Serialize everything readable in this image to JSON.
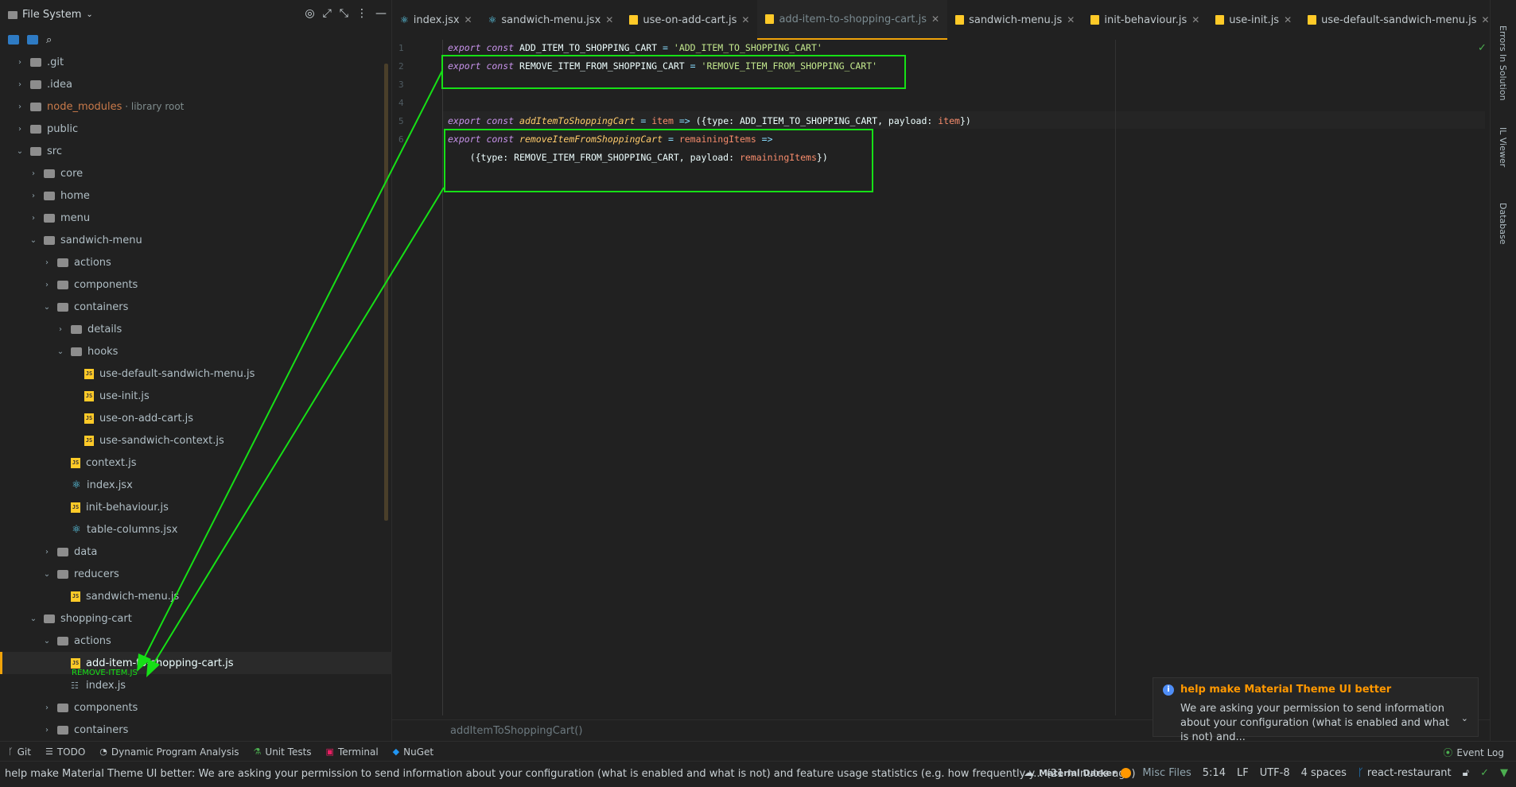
{
  "sidebar": {
    "title": "File System",
    "tree": [
      {
        "label": "git_l",
        "name": ".git"
      },
      {
        "name": ".idea"
      },
      {
        "name": "node_modules",
        "suffix": "library root"
      },
      {
        "name": "public"
      },
      {
        "name": "src"
      },
      {
        "name": "core"
      },
      {
        "name": "home"
      },
      {
        "name": "menu"
      },
      {
        "name": "sandwich-menu"
      },
      {
        "name": "actions"
      },
      {
        "name": "components"
      },
      {
        "name": "containers"
      },
      {
        "name": "details"
      },
      {
        "name": "hooks"
      },
      {
        "name": "use-default-sandwich-menu.js"
      },
      {
        "name": "use-init.js"
      },
      {
        "name": "use-on-add-cart.js"
      },
      {
        "name": "use-sandwich-context.js"
      },
      {
        "name": "context.js"
      },
      {
        "name": "index.jsx"
      },
      {
        "name": "init-behaviour.js"
      },
      {
        "name": "table-columns.jsx"
      },
      {
        "name": "data"
      },
      {
        "name": "reducers"
      },
      {
        "name": "sandwich-menu.js"
      },
      {
        "name": "shopping-cart"
      },
      {
        "name": "actions"
      },
      {
        "name": "add-item-to-shopping-cart.js"
      },
      {
        "name": "index.js"
      },
      {
        "name": "components"
      },
      {
        "name": "containers"
      }
    ],
    "drag_ghost": "REMOVE-ITEM.JS"
  },
  "tabs": [
    {
      "label": "index.jsx",
      "kind": "react"
    },
    {
      "label": "sandwich-menu.jsx",
      "kind": "react"
    },
    {
      "label": "use-on-add-cart.js",
      "kind": "js"
    },
    {
      "label": "add-item-to-shopping-cart.js",
      "kind": "js",
      "active": true
    },
    {
      "label": "sandwich-menu.js",
      "kind": "js"
    },
    {
      "label": "init-behaviour.js",
      "kind": "js"
    },
    {
      "label": "use-init.js",
      "kind": "js"
    },
    {
      "label": "use-default-sandwich-menu.js",
      "kind": "js"
    }
  ],
  "editor": {
    "line_numbers": [
      "1",
      "2",
      "3",
      "4",
      "5",
      "6"
    ],
    "code": {
      "l1_kw": "export const",
      "l1_name": " ADD_ITEM_TO_SHOPPING_CART ",
      "l1_op": "=",
      "l1_str": " 'ADD_ITEM_TO_SHOPPING_CART'",
      "l2_kw": "export const",
      "l2_name": " REMOVE_ITEM_FROM_SHOPPING_CART ",
      "l2_op": "=",
      "l2_str": " 'REMOVE_ITEM_FROM_SHOPPING_CART'",
      "l5_kw": "export const",
      "l5_fn": " addItemToShoppingCart",
      "l5_op": " = ",
      "l5_par": "item",
      "l5_arrow": " => ",
      "l5_body1": "({type: ADD_ITEM_TO_SHOPPING_CART, payload: ",
      "l5_par2": "item",
      "l5_body2": "})",
      "l6_kw": "export const",
      "l6_fn": " removeItemFromShoppingCart",
      "l6_op": " = ",
      "l6_par": "remainingItems",
      "l6_arrow": " =>",
      "l7_body1": "    ({type: REMOVE_ITEM_FROM_SHOPPING_CART, payload: ",
      "l7_par": "remainingItems",
      "l7_body2": "})"
    },
    "breadcrumb": "addItemToShoppingCart()"
  },
  "right_toolbar": {
    "errors": "Errors In Solution",
    "il_viewer": "IL Viewer",
    "database": "Database"
  },
  "notification": {
    "title": "help make Material Theme UI better",
    "body": "We are asking your permission to send information about your configuration (what is enabled and what is not) and..."
  },
  "tool_windows": [
    "Git",
    "TODO",
    "Dynamic Program Analysis",
    "Unit Tests",
    "Terminal",
    "NuGet"
  ],
  "event_log": "Event Log",
  "status": {
    "message": "help make Material Theme UI better: We are asking your permission to send information about your configuration (what is enabled and what is not) and feature usage statistics (e.g. how frequently y... (21 minutes ago)",
    "theme": "Material Darker",
    "misc": "Misc Files",
    "position": "5:14",
    "line_sep": "LF",
    "encoding": "UTF-8",
    "indent": "4 spaces",
    "branch": "react-restaurant"
  },
  "colors": {
    "accent": "#f0a30a",
    "highlight_box": "#16e016",
    "notif_title": "#ff9800"
  }
}
